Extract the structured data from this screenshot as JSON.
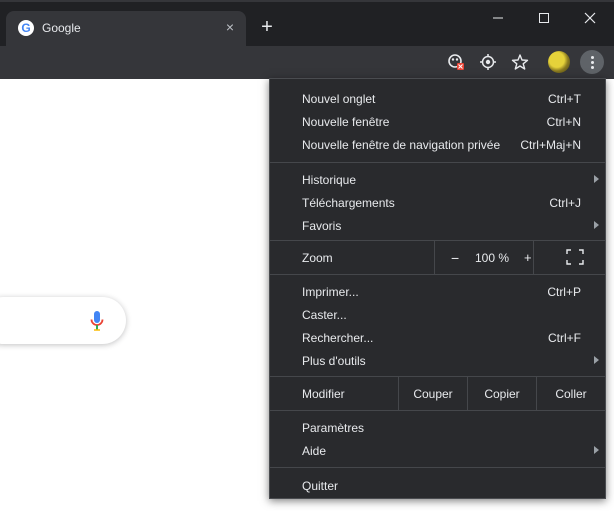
{
  "tab": {
    "title": "Google",
    "favicon": "google-g-icon",
    "close": "×"
  },
  "newtab_label": "+",
  "colors": {
    "titlebar": "#202124",
    "toolbar": "#35363a",
    "menu_bg": "#292a2d",
    "menu_text": "#e8eaed",
    "separator": "#45474b",
    "page_bg": "#ffffff"
  },
  "toolbar": {
    "icons": [
      "extension-blocked-icon",
      "location-target-icon",
      "star-icon",
      "profile-avatar",
      "more-vert-icon"
    ]
  },
  "menu": {
    "group1": [
      {
        "label": "Nouvel onglet",
        "shortcut": "Ctrl+T"
      },
      {
        "label": "Nouvelle fenêtre",
        "shortcut": "Ctrl+N"
      },
      {
        "label": "Nouvelle fenêtre de navigation privée",
        "shortcut": "Ctrl+Maj+N"
      }
    ],
    "group2": [
      {
        "label": "Historique",
        "submenu": true
      },
      {
        "label": "Téléchargements",
        "shortcut": "Ctrl+J"
      },
      {
        "label": "Favoris",
        "submenu": true
      }
    ],
    "zoom": {
      "label": "Zoom",
      "minus": "−",
      "value": "100 %",
      "plus": "+"
    },
    "group3": [
      {
        "label": "Imprimer...",
        "shortcut": "Ctrl+P"
      },
      {
        "label": "Caster..."
      },
      {
        "label": "Rechercher...",
        "shortcut": "Ctrl+F"
      },
      {
        "label": "Plus d'outils",
        "submenu": true
      }
    ],
    "edit": {
      "label": "Modifier",
      "cut": "Couper",
      "copy": "Copier",
      "paste": "Coller"
    },
    "group4": [
      {
        "label": "Paramètres"
      },
      {
        "label": "Aide",
        "submenu": true
      }
    ],
    "quit": {
      "label": "Quitter"
    }
  }
}
